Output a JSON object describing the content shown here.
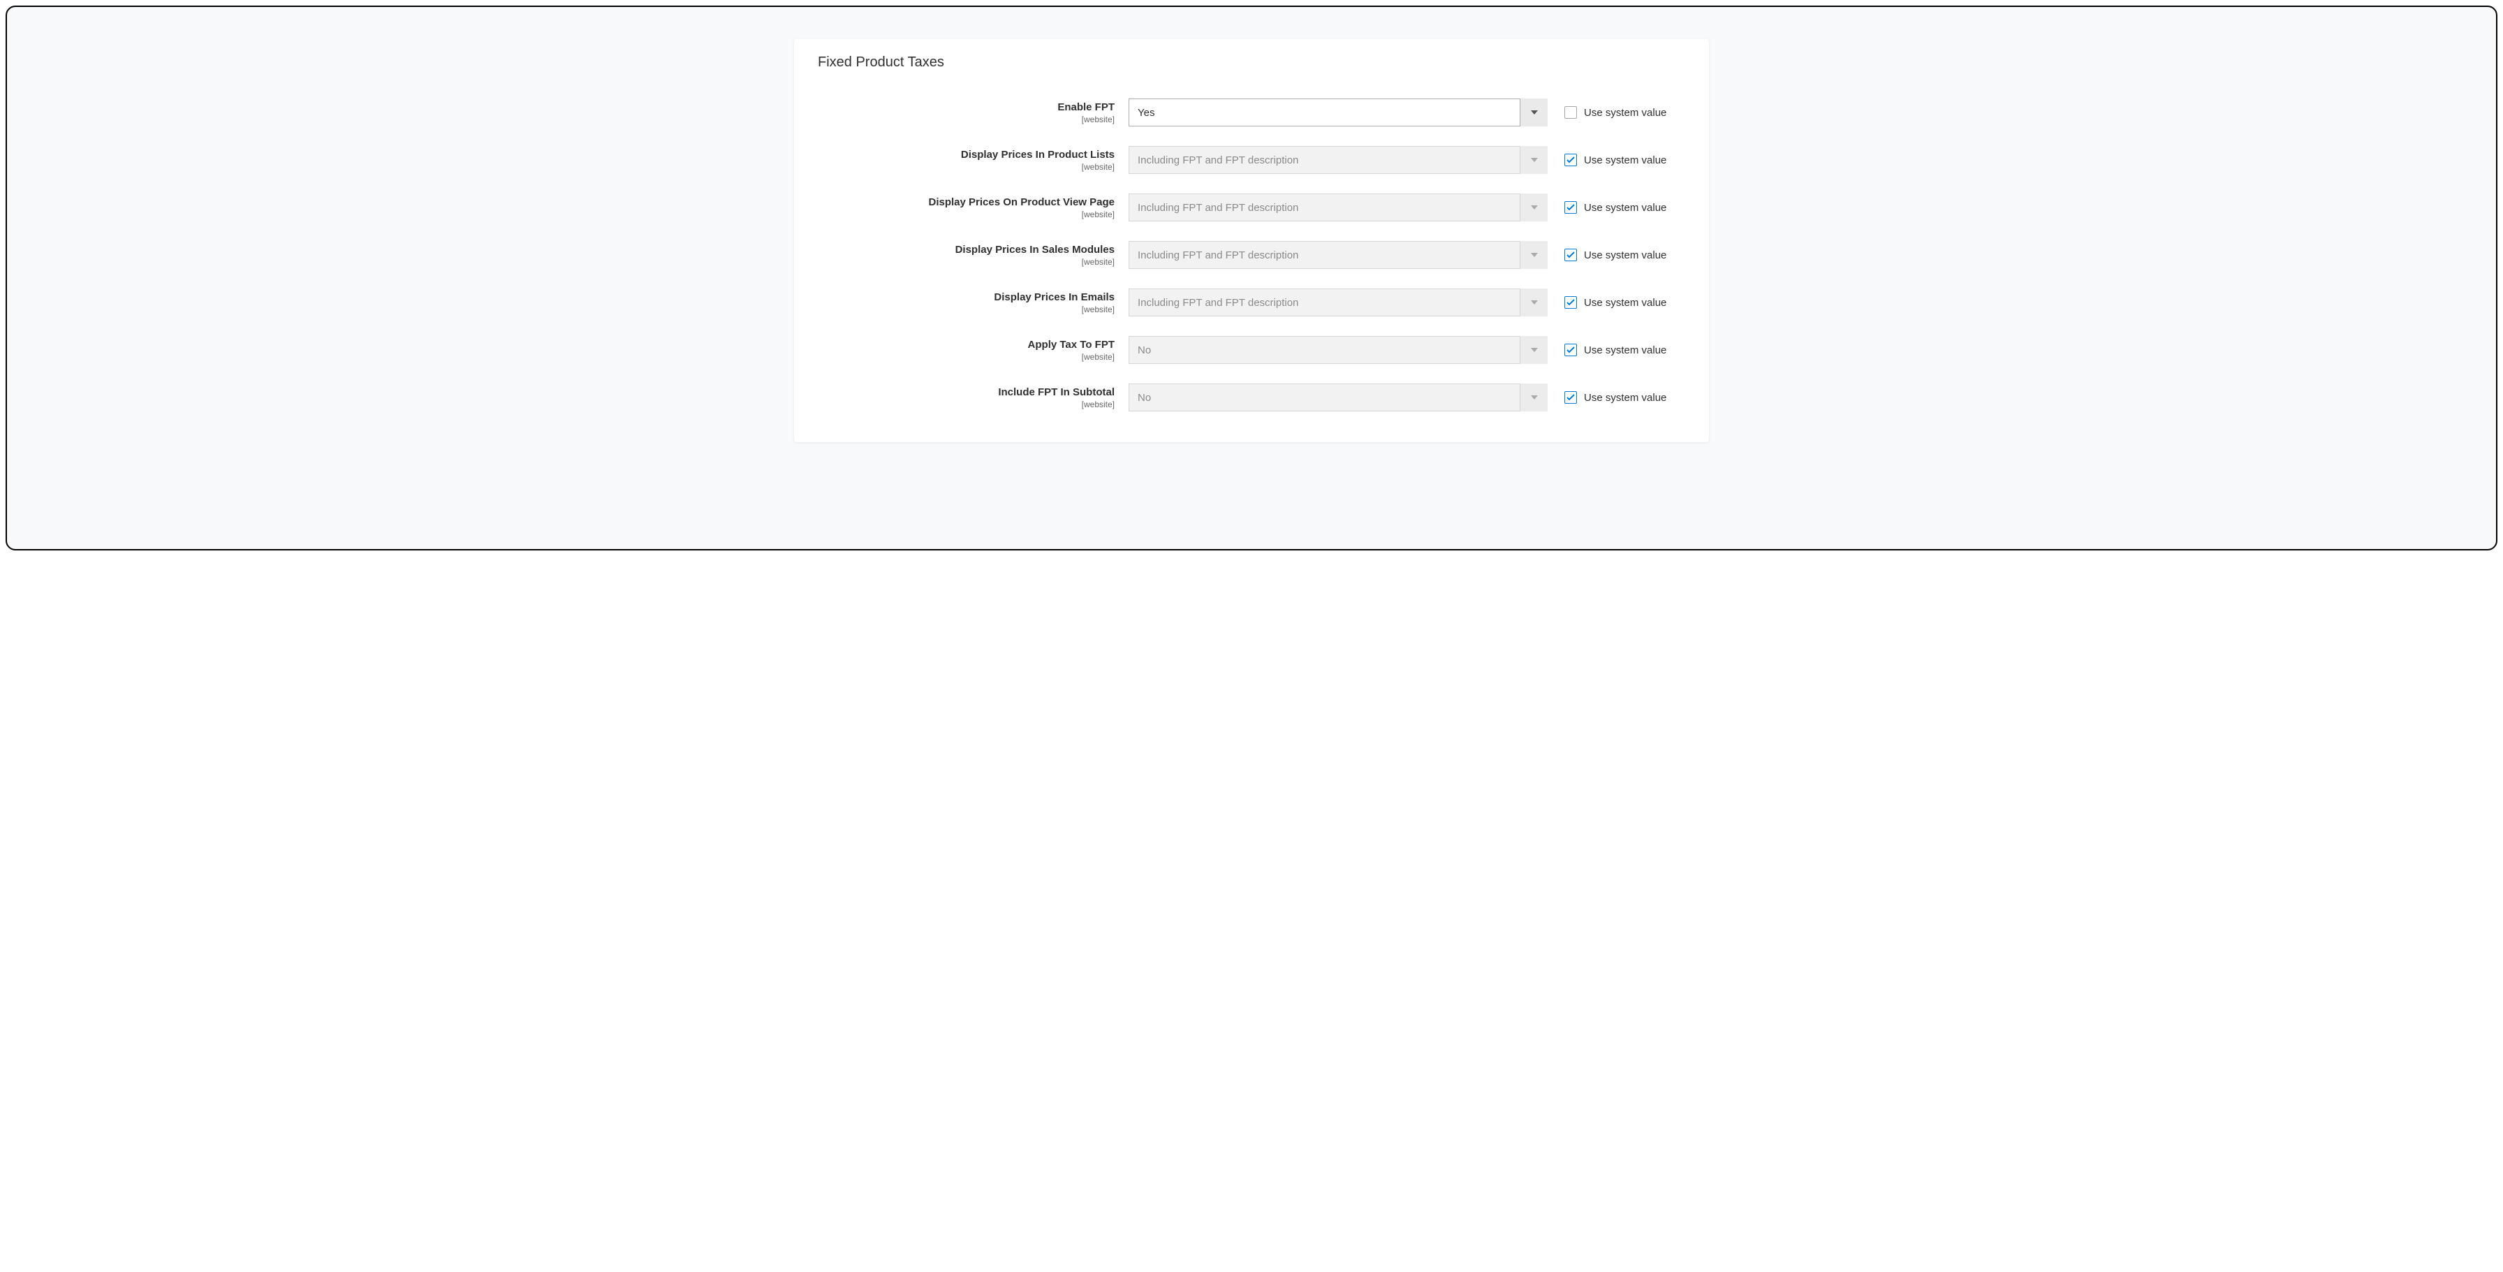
{
  "panel_title": "Fixed Product Taxes",
  "use_system_value_label": "Use system value",
  "fields": [
    {
      "label": "Enable FPT",
      "scope": "[website]",
      "value": "Yes",
      "system_checked": false
    },
    {
      "label": "Display Prices In Product Lists",
      "scope": "[website]",
      "value": "Including FPT and FPT description",
      "system_checked": true
    },
    {
      "label": "Display Prices On Product View Page",
      "scope": "[website]",
      "value": "Including FPT and FPT description",
      "system_checked": true
    },
    {
      "label": "Display Prices In Sales Modules",
      "scope": "[website]",
      "value": "Including FPT and FPT description",
      "system_checked": true
    },
    {
      "label": "Display Prices In Emails",
      "scope": "[website]",
      "value": "Including FPT and FPT description",
      "system_checked": true
    },
    {
      "label": "Apply Tax To FPT",
      "scope": "[website]",
      "value": "No",
      "system_checked": true
    },
    {
      "label": "Include FPT In Subtotal",
      "scope": "[website]",
      "value": "No",
      "system_checked": true
    }
  ]
}
